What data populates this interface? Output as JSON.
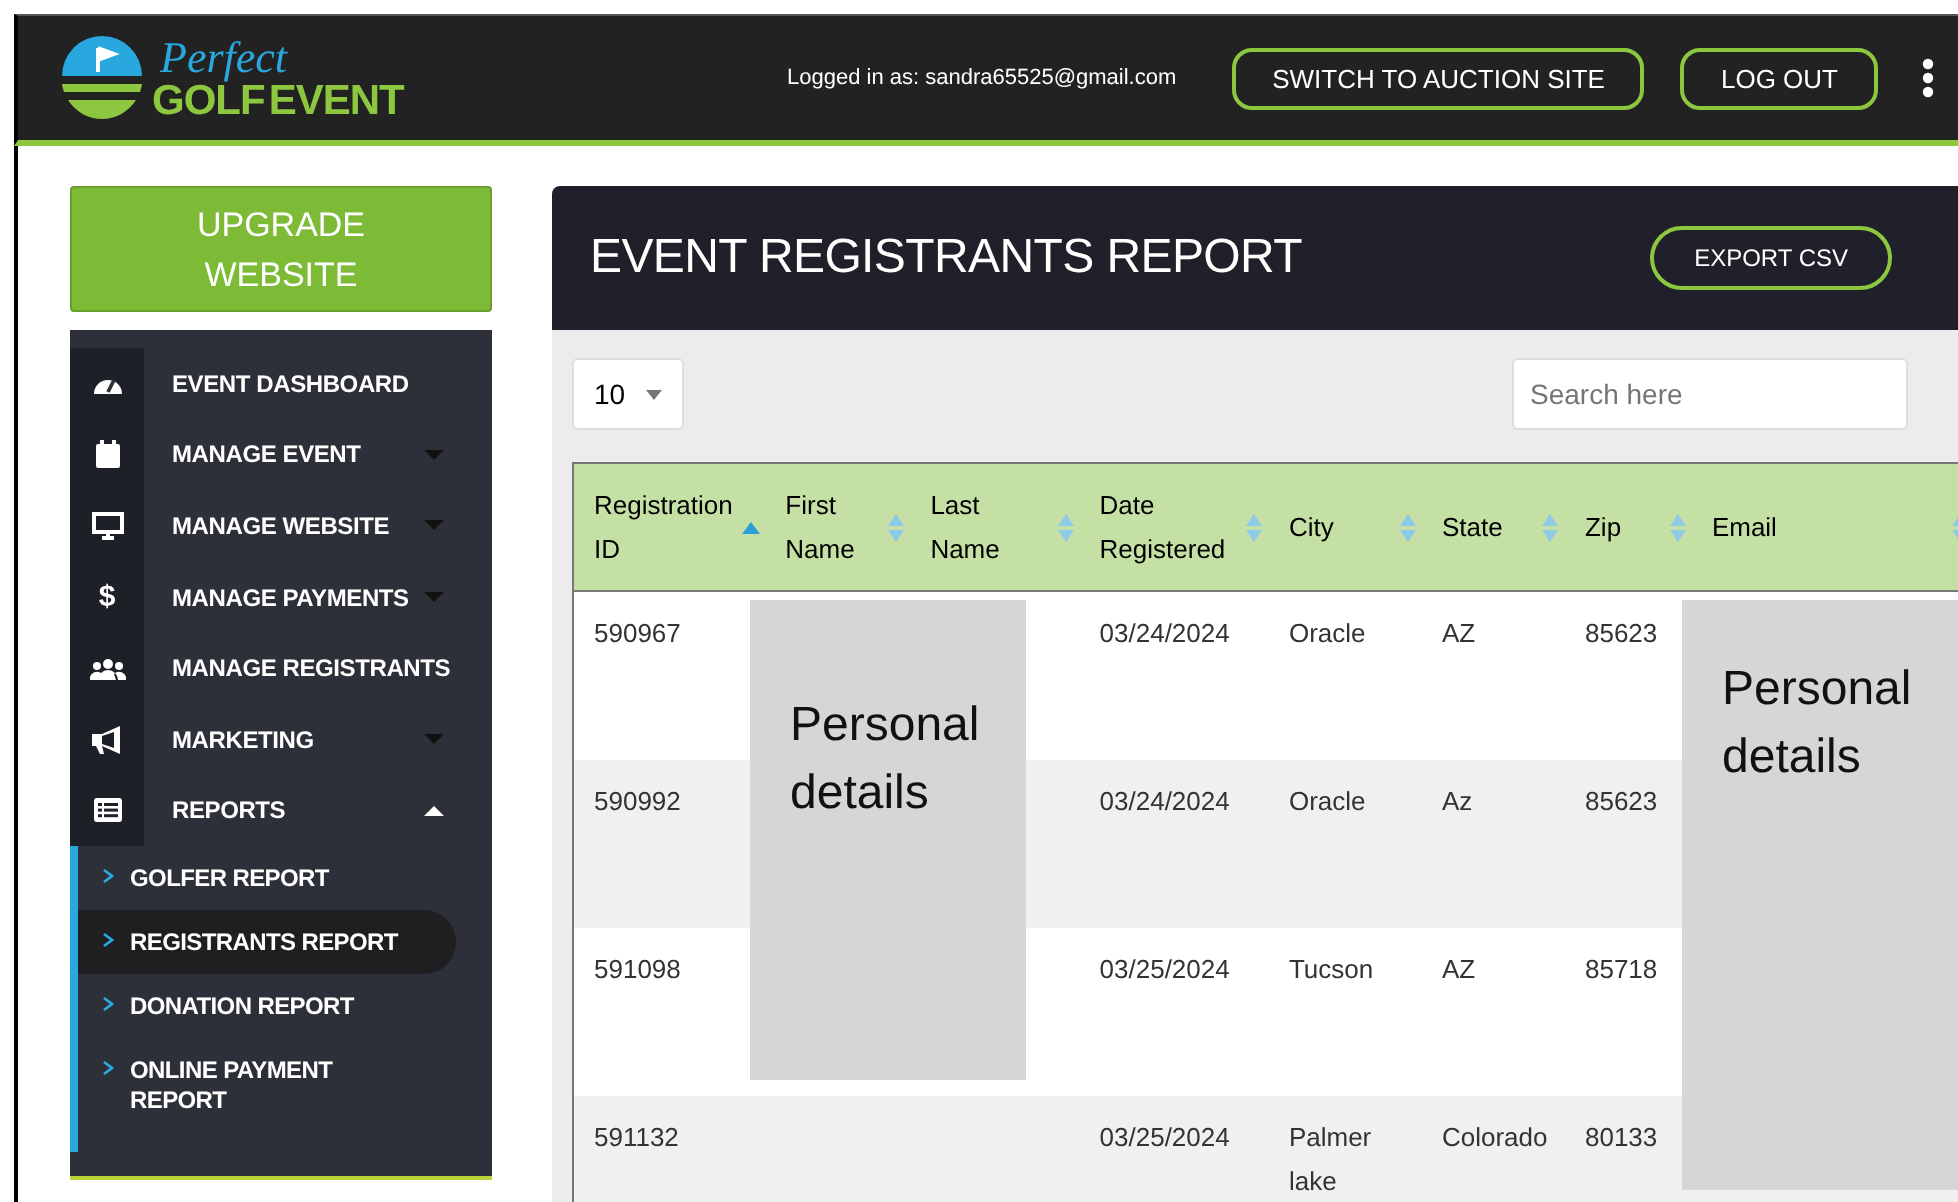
{
  "header": {
    "logo": {
      "line1": "Perfect",
      "line2": "GOLF",
      "line3": "EVENT"
    },
    "logged_in": "Logged in as: sandra65525@gmail.com",
    "buttons": [
      "SWITCH TO AUCTION SITE",
      "LOG OUT"
    ]
  },
  "sidebar": {
    "upgrade": "UPGRADE WEBSITE",
    "items": [
      {
        "label": "EVENT DASHBOARD"
      },
      {
        "label": "MANAGE EVENT",
        "expanded": false
      },
      {
        "label": "MANAGE WEBSITE",
        "expanded": false
      },
      {
        "glyph": "$",
        "label": "MANAGE PAYMENTS",
        "expanded": false
      },
      {
        "label": "MANAGE REGISTRANTS"
      },
      {
        "label": "MARKETING",
        "expanded": false
      },
      {
        "label": "REPORTS",
        "expanded": true,
        "children": [
          {
            "label": "GOLFER REPORT",
            "selected": false
          },
          {
            "label": "REGISTRANTS REPORT",
            "selected": true
          },
          {
            "label": "DONATION REPORT",
            "selected": false
          },
          {
            "label": "ONLINE PAYMENT REPORT",
            "selected": false
          }
        ]
      }
    ]
  },
  "report": {
    "title": "EVENT REGISTRANTS REPORT",
    "export": "EXPORT CSV",
    "page_size": "10",
    "search": {
      "placeholder": "Search here"
    },
    "table": {
      "columns": [
        {
          "label": "Registration ID",
          "sorted": true
        },
        {
          "label": "First Name",
          "sorted": false
        },
        {
          "label": "Last Name",
          "sorted": false
        },
        {
          "label": "Date Registered",
          "sorted": false
        },
        {
          "label": "City",
          "sorted": false
        },
        {
          "label": "State",
          "sorted": false
        },
        {
          "label": "Zip",
          "sorted": false
        },
        {
          "label": "Email",
          "sorted": false
        }
      ],
      "rows": [
        {
          "id": "590967",
          "date": "03/24/2024",
          "city": "Oracle",
          "state": "AZ",
          "zip": "85623"
        },
        {
          "id": "590992",
          "date": "03/24/2024",
          "city": "Oracle",
          "state": "Az",
          "zip": "85623"
        },
        {
          "id": "591098",
          "date": "03/25/2024",
          "city": "Tucson",
          "state": "AZ",
          "zip": "85718"
        },
        {
          "id": "591132",
          "date": "03/25/2024",
          "city": "Palmer lake",
          "state": "Colorado",
          "zip": "80133"
        }
      ]
    },
    "redactions": [
      "Personal details",
      "Personal details"
    ]
  }
}
